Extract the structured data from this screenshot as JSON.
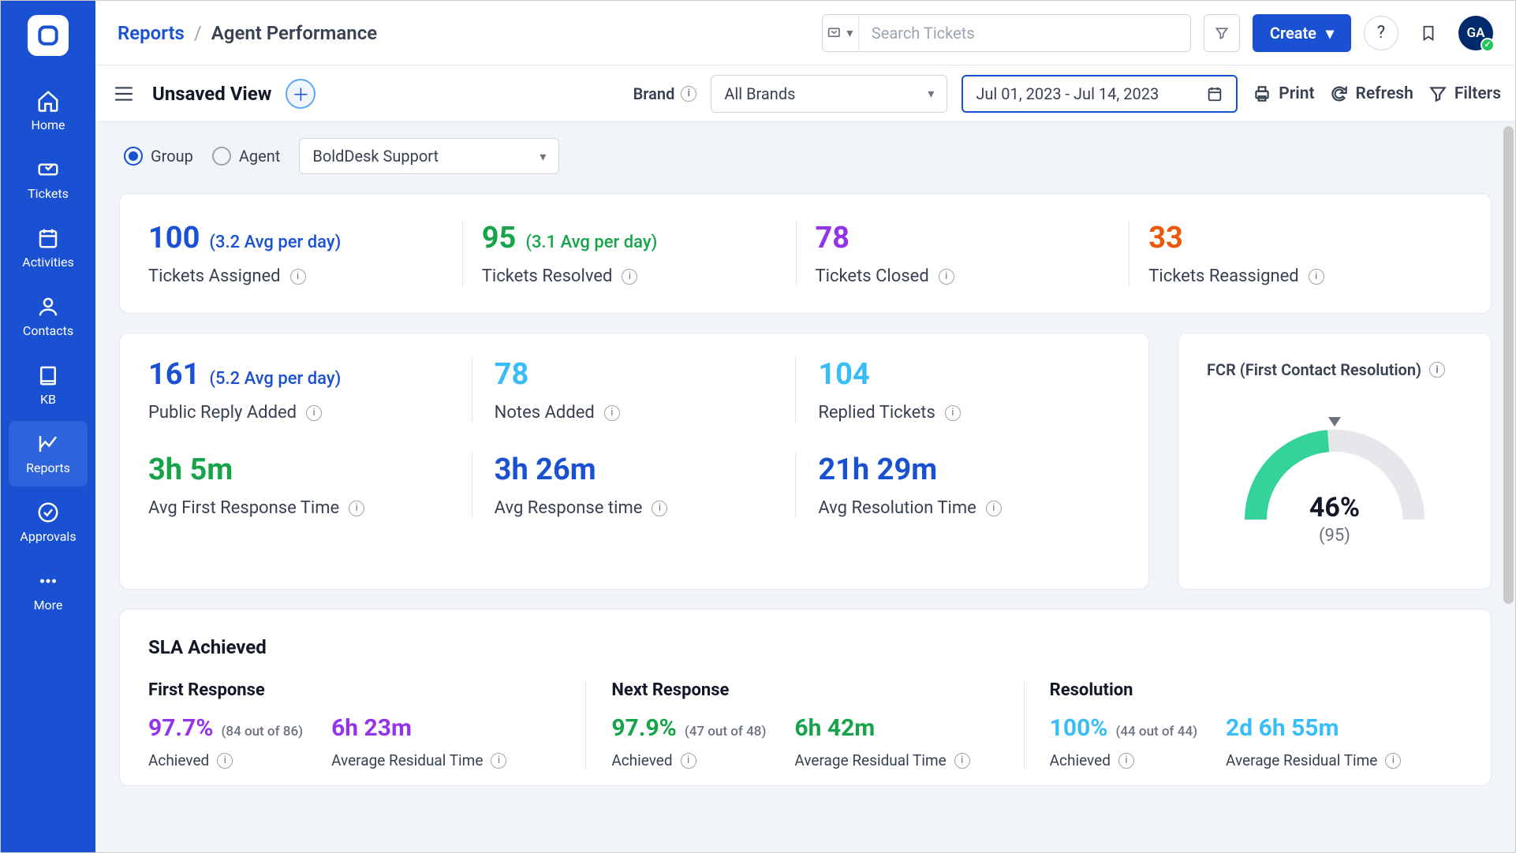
{
  "sidebar": {
    "items": [
      {
        "label": "Home"
      },
      {
        "label": "Tickets"
      },
      {
        "label": "Activities"
      },
      {
        "label": "Contacts"
      },
      {
        "label": "KB"
      },
      {
        "label": "Reports"
      },
      {
        "label": "Approvals"
      },
      {
        "label": "More"
      }
    ]
  },
  "header": {
    "breadcrumb_root": "Reports",
    "breadcrumb_current": "Agent Performance",
    "search_placeholder": "Search Tickets",
    "create_label": "Create",
    "avatar_initials": "GA"
  },
  "viewbar": {
    "title": "Unsaved View",
    "brand_label": "Brand",
    "brand_select": "All Brands",
    "date_range": "Jul 01, 2023 - Jul 14, 2023",
    "print": "Print",
    "refresh": "Refresh",
    "filters": "Filters"
  },
  "controls": {
    "group_label": "Group",
    "agent_label": "Agent",
    "group_select": "BoldDesk Support"
  },
  "top_metrics": [
    {
      "value": "100",
      "sub": "(3.2 Avg per day)",
      "label": "Tickets Assigned",
      "color": "color-blue"
    },
    {
      "value": "95",
      "sub": "(3.1 Avg per day)",
      "label": "Tickets Resolved",
      "color": "color-green"
    },
    {
      "value": "78",
      "sub": "",
      "label": "Tickets Closed",
      "color": "color-purple"
    },
    {
      "value": "33",
      "sub": "",
      "label": "Tickets Reassigned",
      "color": "color-orange"
    }
  ],
  "mid_metrics": [
    {
      "value": "161",
      "sub": "(5.2 Avg per day)",
      "label": "Public Reply Added",
      "color": "color-blue"
    },
    {
      "value": "78",
      "sub": "",
      "label": "Notes Added",
      "color": "color-lightblue"
    },
    {
      "value": "104",
      "sub": "",
      "label": "Replied Tickets",
      "color": "color-lightblue"
    },
    {
      "value": "3h 5m",
      "sub": "",
      "label": "Avg First Response Time",
      "color": "color-green"
    },
    {
      "value": "3h 26m",
      "sub": "",
      "label": "Avg Response time",
      "color": "color-blue"
    },
    {
      "value": "21h 29m",
      "sub": "",
      "label": "Avg Resolution Time",
      "color": "color-blue"
    }
  ],
  "fcr": {
    "title": "FCR (First Contact Resolution)",
    "percent_label": "46%",
    "sub": "(95)"
  },
  "sla": {
    "title": "SLA Achieved",
    "cols": [
      {
        "title": "First Response",
        "achieved": {
          "value": "97.7%",
          "sub": "(84 out of 86)",
          "label": "Achieved",
          "color": "color-purple"
        },
        "residual": {
          "value": "6h 23m",
          "label": "Average Residual Time",
          "color": "color-purple"
        }
      },
      {
        "title": "Next Response",
        "achieved": {
          "value": "97.9%",
          "sub": "(47 out of 48)",
          "label": "Achieved",
          "color": "color-green"
        },
        "residual": {
          "value": "6h 42m",
          "label": "Average Residual Time",
          "color": "color-green"
        }
      },
      {
        "title": "Resolution",
        "achieved": {
          "value": "100%",
          "sub": "(44 out of 44)",
          "label": "Achieved",
          "color": "color-lightblue"
        },
        "residual": {
          "value": "2d 6h 55m",
          "label": "Average Residual Time",
          "color": "color-lightblue"
        }
      }
    ]
  },
  "chart_data": {
    "type": "gauge",
    "title": "FCR (First Contact Resolution)",
    "value": 46,
    "min": 0,
    "max": 100,
    "count": 95,
    "unit": "%"
  }
}
